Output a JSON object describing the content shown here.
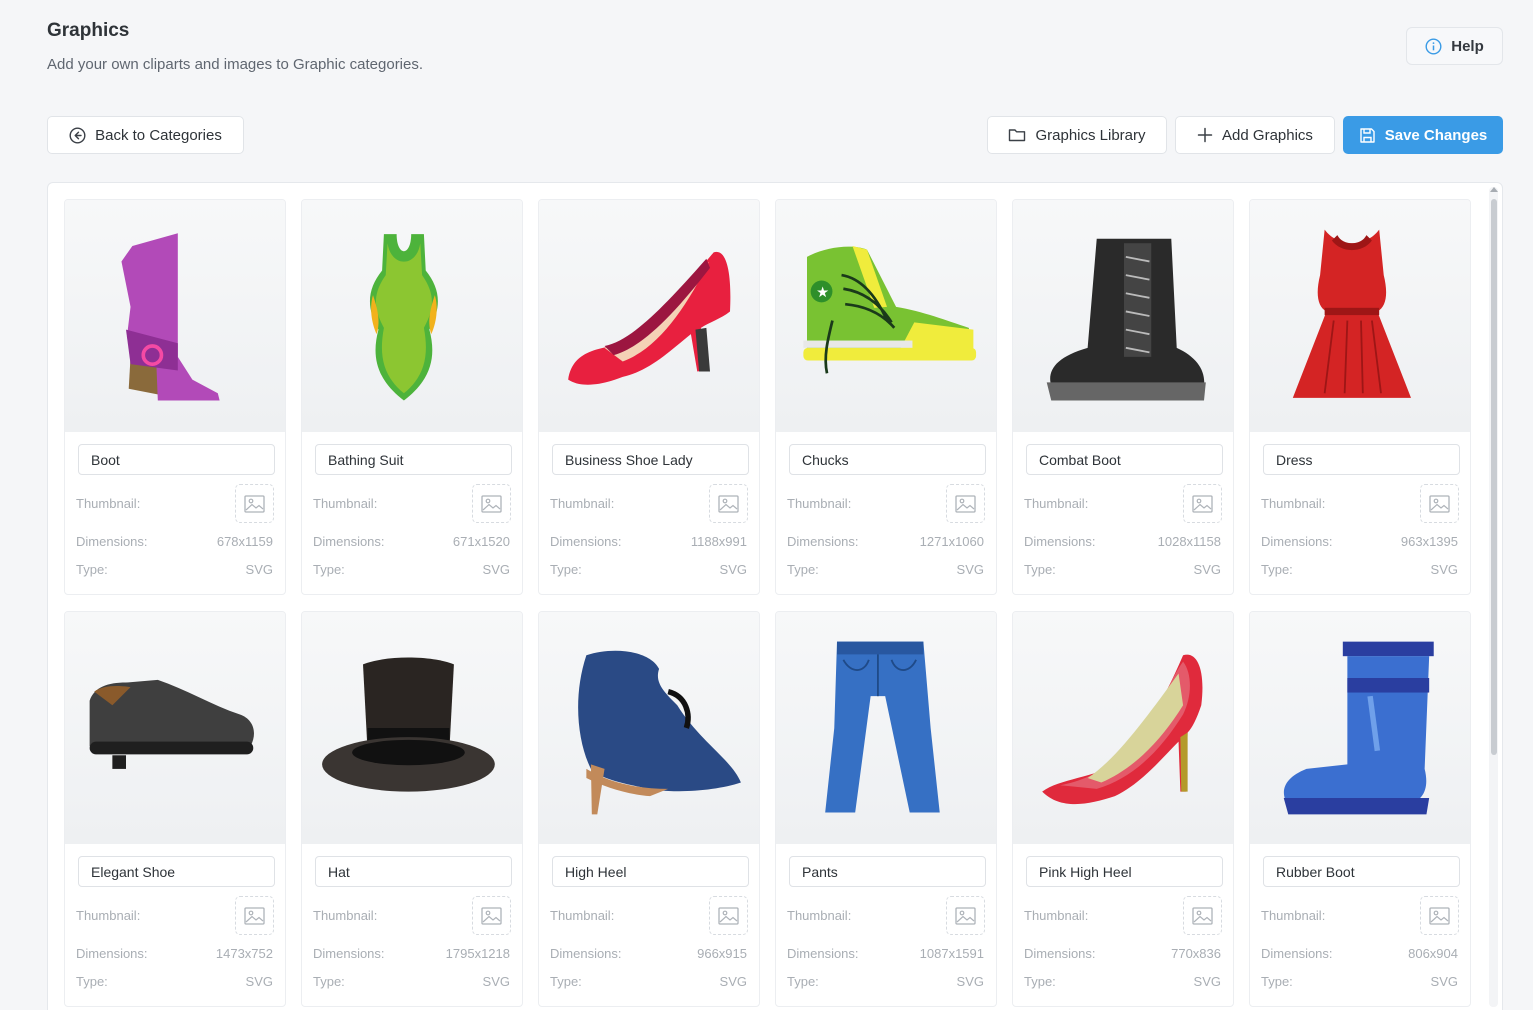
{
  "header": {
    "title": "Graphics",
    "subtitle": "Add your own cliparts and images to Graphic categories.",
    "help_label": "Help"
  },
  "toolbar": {
    "back_label": "Back to Categories",
    "library_label": "Graphics Library",
    "add_label": "Add Graphics",
    "save_label": "Save Changes"
  },
  "labels": {
    "thumbnail": "Thumbnail:",
    "dimensions": "Dimensions:",
    "type": "Type:"
  },
  "colors": {
    "primary": "#3a9be6",
    "background": "#f5f6f8"
  },
  "graphics": [
    {
      "name": "Boot",
      "dimensions": "678x1159",
      "type": "SVG",
      "icon": "purple-boot"
    },
    {
      "name": "Bathing Suit",
      "dimensions": "671x1520",
      "type": "SVG",
      "icon": "green-bathing-suit"
    },
    {
      "name": "Business Shoe Lady",
      "dimensions": "1188x991",
      "type": "SVG",
      "icon": "red-pump"
    },
    {
      "name": "Chucks",
      "dimensions": "1271x1060",
      "type": "SVG",
      "icon": "green-sneaker"
    },
    {
      "name": "Combat Boot",
      "dimensions": "1028x1158",
      "type": "SVG",
      "icon": "black-combat-boot"
    },
    {
      "name": "Dress",
      "dimensions": "963x1395",
      "type": "SVG",
      "icon": "red-dress"
    },
    {
      "name": "Elegant Shoe",
      "dimensions": "1473x752",
      "type": "SVG",
      "icon": "black-dress-shoe"
    },
    {
      "name": "Hat",
      "dimensions": "1795x1218",
      "type": "SVG",
      "icon": "top-hat"
    },
    {
      "name": "High Heel",
      "dimensions": "966x915",
      "type": "SVG",
      "icon": "blue-ankle-heel"
    },
    {
      "name": "Pants",
      "dimensions": "1087x1591",
      "type": "SVG",
      "icon": "blue-jeans"
    },
    {
      "name": "Pink High Heel",
      "dimensions": "770x836",
      "type": "SVG",
      "icon": "pink-stiletto"
    },
    {
      "name": "Rubber Boot",
      "dimensions": "806x904",
      "type": "SVG",
      "icon": "blue-rubber-boot"
    }
  ]
}
